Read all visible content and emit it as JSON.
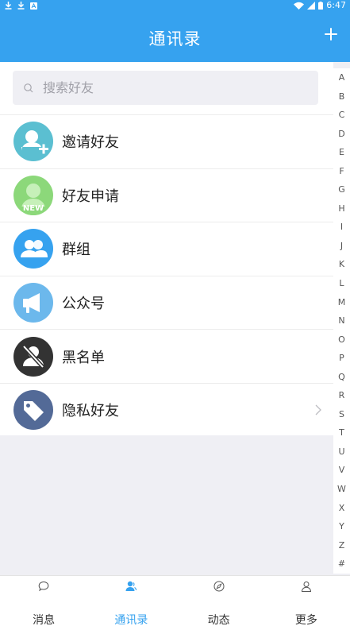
{
  "status": {
    "time": "6:47"
  },
  "header": {
    "title": "通讯录"
  },
  "search": {
    "placeholder": "搜索好友"
  },
  "list": [
    {
      "label": "邀请好友",
      "icon": "invite-user-icon",
      "color": "#5bbfd1"
    },
    {
      "label": "好友申请",
      "icon": "friend-request-icon",
      "color": "#8cd87a",
      "badge": "NEW"
    },
    {
      "label": "群组",
      "icon": "group-icon",
      "color": "#36a2ef"
    },
    {
      "label": "公众号",
      "icon": "megaphone-icon",
      "color": "#6cb8ec"
    },
    {
      "label": "黑名单",
      "icon": "blocked-user-icon",
      "color": "#333333"
    },
    {
      "label": "隐私好友",
      "icon": "tag-icon",
      "color": "#536a97"
    }
  ],
  "index_letters": [
    "A",
    "B",
    "C",
    "D",
    "E",
    "F",
    "G",
    "H",
    "I",
    "J",
    "K",
    "L",
    "M",
    "N",
    "O",
    "P",
    "Q",
    "R",
    "S",
    "T",
    "U",
    "V",
    "W",
    "X",
    "Y",
    "Z",
    "#"
  ],
  "tabs": [
    {
      "label": "消息",
      "icon": "chat-icon"
    },
    {
      "label": "通讯录",
      "icon": "contacts-icon",
      "active": true
    },
    {
      "label": "动态",
      "icon": "compass-icon"
    },
    {
      "label": "更多",
      "icon": "person-icon"
    }
  ],
  "colors": {
    "accent": "#36a2ef"
  }
}
